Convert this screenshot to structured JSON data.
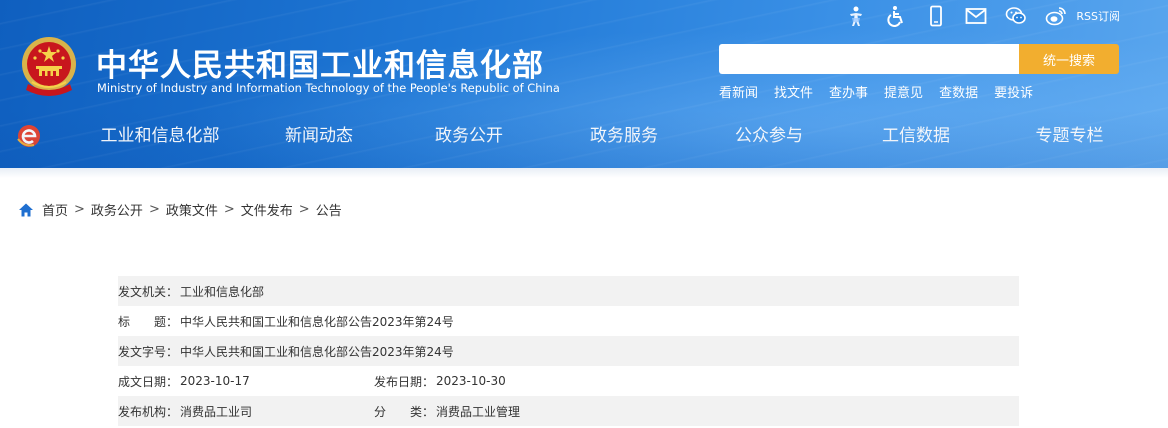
{
  "header": {
    "title_cn": "中华人民共和国工业和信息化部",
    "title_en": "Ministry of Industry and Information Technology of the People's Republic of China",
    "top_icons": [
      "accessibility-figure-icon",
      "wheelchair-icon",
      "mobile-phone-icon",
      "mail-icon",
      "wechat-icon",
      "weibo-icon"
    ],
    "rss_label": "RSS订阅",
    "search": {
      "value": "",
      "placeholder": "",
      "button_label": "统一搜索"
    },
    "quick_links": [
      "看新闻",
      "找文件",
      "查办事",
      "提意见",
      "查数据",
      "要投诉"
    ]
  },
  "nav": {
    "items": [
      "工业和信息化部",
      "新闻动态",
      "政务公开",
      "政务服务",
      "公众参与",
      "工信数据",
      "专题专栏"
    ]
  },
  "breadcrumb": [
    "首页",
    "政务公开",
    "政策文件",
    "文件发布",
    "公告"
  ],
  "breadcrumb_sep": ">",
  "info": {
    "issuer_label": "发文机关：",
    "issuer": "工业和信息化部",
    "title_label": "标　　题：",
    "title": "中华人民共和国工业和信息化部公告2023年第24号",
    "doc_no_label": "发文字号：",
    "doc_no": "中华人民共和国工业和信息化部公告2023年第24号",
    "created_label": "成文日期：",
    "created": "2023-10-17",
    "published_label": "发布日期：",
    "published": "2023-10-30",
    "org_label": "发布机构：",
    "org": "消费品工业司",
    "category_label": "分　　类：",
    "category": "消费品工业管理"
  },
  "colors": {
    "header_blue": "#1f78d6",
    "search_button": "#f2ae2f",
    "row_shade": "#f2f2f2"
  }
}
